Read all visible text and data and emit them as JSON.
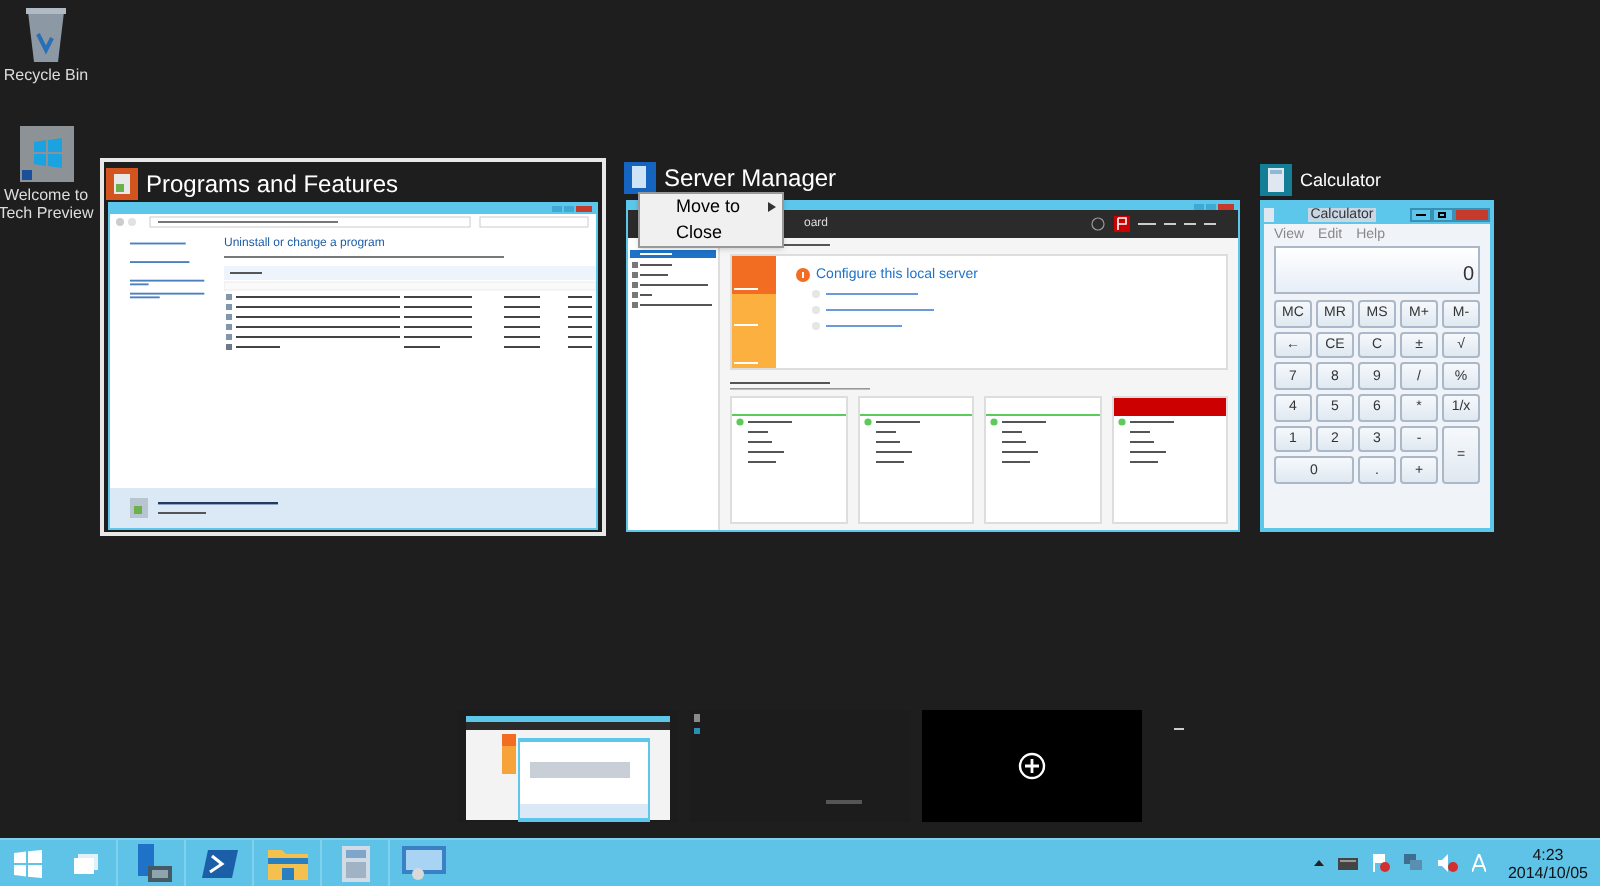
{
  "desktop_icons": [
    {
      "kind": "bin",
      "label": "Recycle Bin"
    },
    {
      "kind": "welcome",
      "label": "Welcome to Tech Preview"
    }
  ],
  "programs_window": {
    "title": "Programs and Features",
    "heading": "Uninstall or change a program"
  },
  "server_window": {
    "title": "Server Manager",
    "breadcrumb": "oard",
    "main_step": "Configure this local server",
    "tiles": [
      {
        "alert": false
      },
      {
        "alert": false
      },
      {
        "alert": false
      },
      {
        "alert": true
      }
    ]
  },
  "context_menu": [
    {
      "label": "Move to",
      "submenu": true
    },
    {
      "label": "Close",
      "submenu": false
    }
  ],
  "calculator_window": {
    "title": "Calculator",
    "inner_title": "Calculator",
    "menu": [
      "View",
      "Edit",
      "Help"
    ],
    "display": "0",
    "keys": [
      [
        "MC",
        "MR",
        "MS",
        "M+",
        "M-"
      ],
      [
        "←",
        "CE",
        "C",
        "±",
        "√"
      ],
      [
        "7",
        "8",
        "9",
        "/",
        "%"
      ],
      [
        "4",
        "5",
        "6",
        "*",
        "1/x"
      ],
      [
        "1",
        "2",
        "3",
        "-",
        "="
      ],
      [
        "0",
        ".",
        "+"
      ]
    ]
  },
  "desktops": [
    {
      "kind": "apps"
    },
    {
      "kind": "empty"
    },
    {
      "kind": "add"
    }
  ],
  "taskbar": {
    "apps": [
      {
        "kind": "start"
      },
      {
        "kind": "taskview"
      },
      {
        "kind": "server"
      },
      {
        "kind": "shell"
      },
      {
        "kind": "folder"
      },
      {
        "kind": "calc"
      },
      {
        "kind": "panel"
      }
    ],
    "time": "4:23",
    "date": "2014/10/05"
  }
}
